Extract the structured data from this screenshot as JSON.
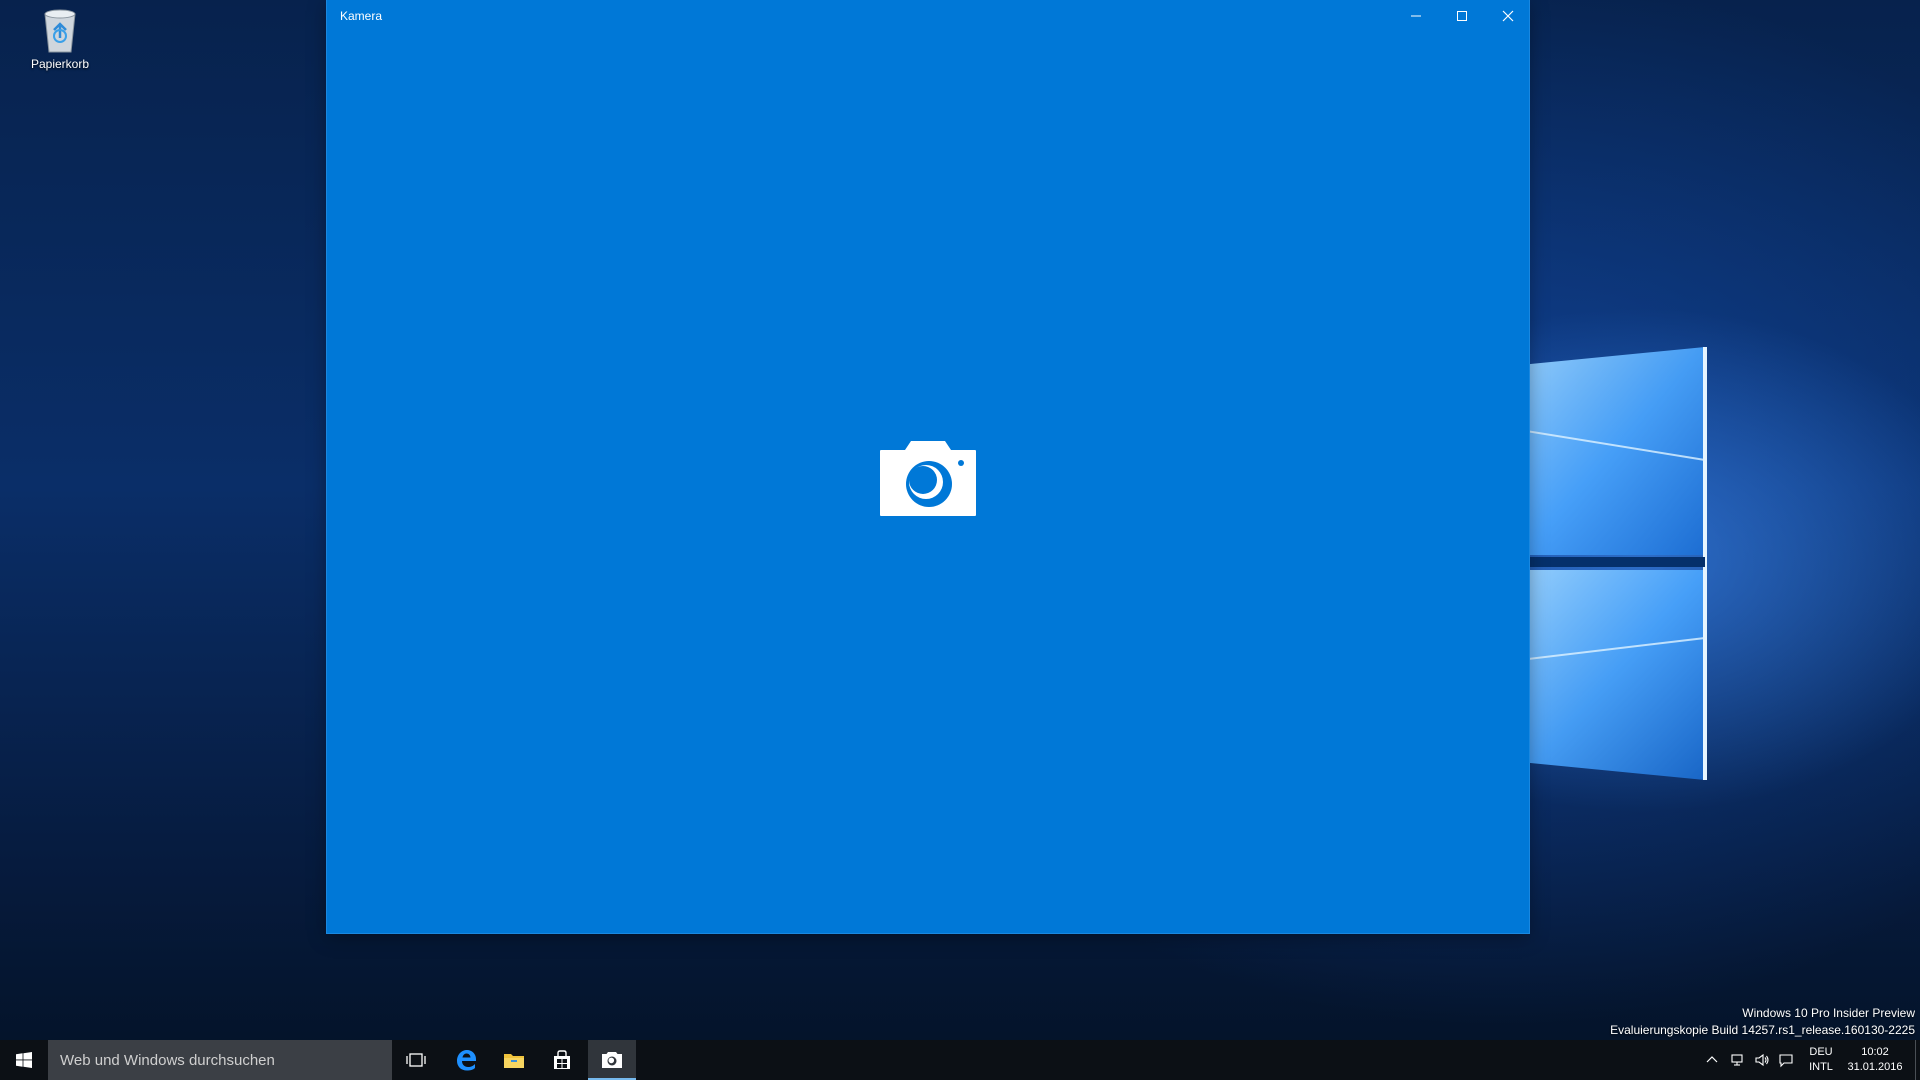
{
  "desktop": {
    "icons": [
      {
        "label": "Papierkorb",
        "icon": "recycle-bin-icon"
      }
    ],
    "watermark": {
      "line1": "Windows 10 Pro Insider Preview",
      "line2": "Evaluierungskopie Build 14257.rs1_release.160130-2225"
    }
  },
  "window": {
    "title": "Kamera",
    "background": "#0078d7",
    "controls": {
      "minimize": "minimize-icon",
      "maximize": "maximize-icon",
      "close": "close-icon"
    },
    "splash_icon": "camera-icon"
  },
  "taskbar": {
    "background": "#0c1015",
    "search": {
      "placeholder": "Web und Windows durchsuchen"
    },
    "pinned": [
      "task-view-icon",
      "edge-icon",
      "file-explorer-icon",
      "store-icon",
      "camera-icon"
    ],
    "active_app": "camera",
    "tray": {
      "lang_top": "DEU",
      "lang_bottom": "INTL",
      "time": "10:02",
      "date": "31.01.2016"
    }
  }
}
